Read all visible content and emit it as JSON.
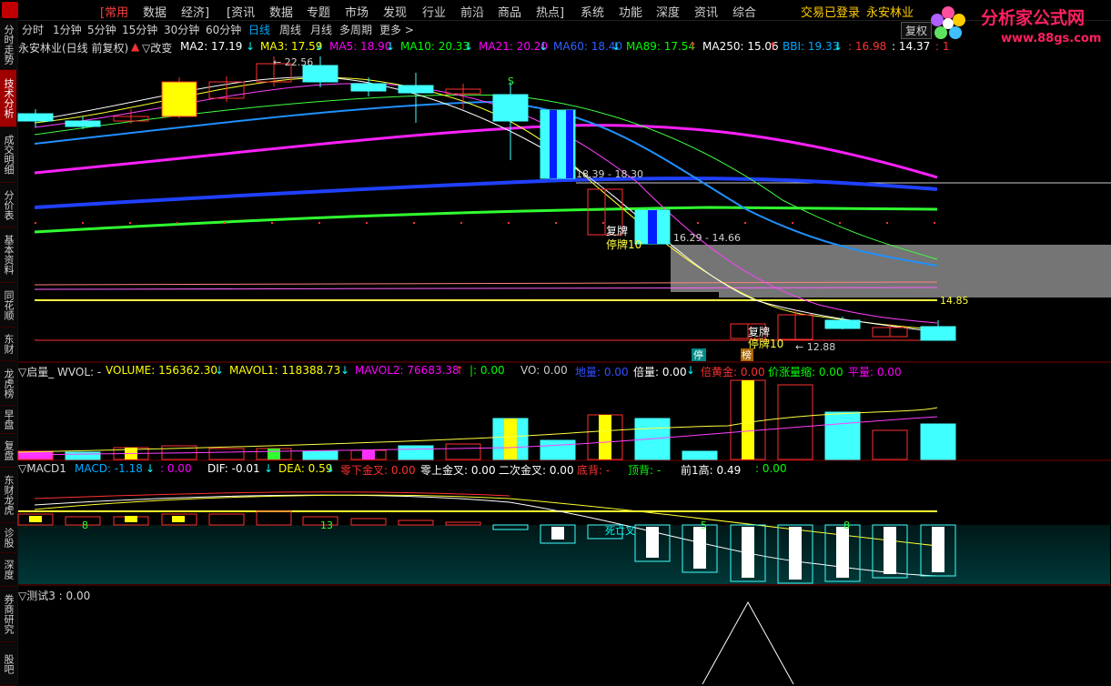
{
  "menu": {
    "items": [
      "[常用",
      "数据",
      "经济]",
      "[资讯",
      "数据",
      "专题",
      "市场",
      "发现",
      "行业",
      "前沿",
      "商品",
      "热点]",
      "系统",
      "功能",
      "深度",
      "资讯",
      "综合"
    ],
    "login_status": "交易已登录",
    "stock_name": "永安林业"
  },
  "watermark": {
    "brand": "分析家公式网",
    "url": "www.88gs.com"
  },
  "timeframes": {
    "items": [
      "分时",
      "1分钟",
      "5分钟",
      "15分钟",
      "30分钟",
      "60分钟",
      "日线",
      "周线",
      "月线",
      "多周期",
      "更多 >"
    ],
    "active": "日线"
  },
  "fuquan_label": "复权",
  "left_tabs": [
    {
      "label": "分时走势",
      "active": false
    },
    {
      "label": "技术分析",
      "active": true
    },
    {
      "label": "成交明细",
      "active": false
    },
    {
      "label": "分价表",
      "active": false
    },
    {
      "label": "基本资料",
      "active": false
    },
    {
      "label": "同花顺",
      "active": false
    },
    {
      "label": "东财",
      "active": false
    },
    {
      "label": "龙虎榜",
      "active": false
    },
    {
      "label": "早盘",
      "active": false
    },
    {
      "label": "复盘",
      "active": false
    },
    {
      "label": "东财龙虎",
      "active": false
    },
    {
      "label": "诊股",
      "active": false
    },
    {
      "label": "深度",
      "active": false
    },
    {
      "label": "券商研究",
      "active": false
    },
    {
      "label": "股吧",
      "active": false
    }
  ],
  "main_panel": {
    "title": "永安林业(日线 前复权)",
    "change_label": "▽改变",
    "indicators": [
      {
        "label": "MA2: 17.19",
        "color": "#ffffff",
        "arrow": "↓",
        "arrow_color": "#00ffff"
      },
      {
        "label": "MA3: 17.59",
        "color": "#ffff00",
        "arrow": "↓",
        "arrow_color": "#00ffff"
      },
      {
        "label": "MA5: 18.90",
        "color": "#ff00ff",
        "arrow": "↓",
        "arrow_color": "#00ffff"
      },
      {
        "label": "MA10: 20.33",
        "color": "#00ff00",
        "arrow": "↓",
        "arrow_color": "#00ffff"
      },
      {
        "label": "MA21: 20.20",
        "color": "#ff00ff",
        "arrow": "↓",
        "arrow_color": "#00ffff"
      },
      {
        "label": "MA60: 18.40",
        "color": "#3060ff",
        "arrow": "↓",
        "arrow_color": "#00ffff"
      },
      {
        "label": "MA89: 17.54",
        "color": "#00ff00",
        "arrow": "↑",
        "arrow_color": "#ff3030"
      },
      {
        "label": "MA250: 15.06",
        "color": "#ffffff",
        "arrow": "↑",
        "arrow_color": "#ff3030"
      },
      {
        "label": "BBI: 19.33",
        "color": "#00aaff",
        "arrow": "↓",
        "arrow_color": "#00ffff"
      },
      {
        "label": ": 16.98",
        "color": "#ff3030",
        "arrow": "",
        "arrow_color": ""
      },
      {
        "label": ": 14.37",
        "color": "#ffffff",
        "arrow": "",
        "arrow_color": ""
      },
      {
        "label": ": 1",
        "color": "#ff3030",
        "arrow": "",
        "arrow_color": ""
      }
    ],
    "annotations": {
      "high_label": "← 22.56",
      "price_range_1": "18.39 - 18.30",
      "price_range_2": "16.29 - 14.66",
      "resume_1": "复牌",
      "halt_1": "停牌10",
      "resume_2": "复牌",
      "halt_2": "停牌10",
      "low_label": "← 12.88",
      "right_level": "14.85",
      "s_mark": "S",
      "tag_halt": "停",
      "tag_list": "榜"
    }
  },
  "volume_panel": {
    "title": "▽启量_ WVOL: -",
    "items": [
      {
        "label": "VOLUME: 156362.30",
        "color": "#ffff00",
        "arrow": "↓",
        "arrow_color": "#00ffff"
      },
      {
        "label": "MAVOL1: 118388.73",
        "color": "#ffff00",
        "arrow": "↓",
        "arrow_color": "#00ffff"
      },
      {
        "label": "MAVOL2: 76683.38",
        "color": "#ff00ff",
        "arrow": "↑",
        "arrow_color": "#ff3030"
      },
      {
        "label": "|: 0.00",
        "color": "#00ff00",
        "arrow": "",
        "arrow_color": ""
      },
      {
        "label": "VO: 0.00",
        "color": "#c8c8c8",
        "arrow": "",
        "arrow_color": ""
      },
      {
        "label": "地量: 0.00",
        "color": "#3050ff",
        "arrow": "",
        "arrow_color": ""
      },
      {
        "label": "倍量: 0.00",
        "color": "#ffffff",
        "arrow": "↓",
        "arrow_color": "#00ffff"
      },
      {
        "label": "倍黄金: 0.00",
        "color": "#ff3030",
        "arrow": "",
        "arrow_color": ""
      },
      {
        "label": "价涨量缩: 0.00",
        "color": "#00ff00",
        "arrow": "",
        "arrow_color": ""
      },
      {
        "label": "平量: 0.00",
        "color": "#ff00ff",
        "arrow": "",
        "arrow_color": ""
      }
    ]
  },
  "macd_panel": {
    "title": "▽MACD1",
    "items": [
      {
        "label": "MACD: -1.18",
        "color": "#00aaff",
        "arrow": "↓",
        "arrow_color": "#00ffff"
      },
      {
        "label": ": 0.00",
        "color": "#ff00ff",
        "arrow": "",
        "arrow_color": ""
      },
      {
        "label": "DIF: -0.01",
        "color": "#ffffff",
        "arrow": "↓",
        "arrow_color": "#00ffff"
      },
      {
        "label": "DEA: 0.59",
        "color": "#ffff00",
        "arrow": "↓",
        "arrow_color": "#00ffff"
      },
      {
        "label": "零下金叉: 0.00",
        "color": "#ff3030",
        "arrow": "",
        "arrow_color": ""
      },
      {
        "label": "零上金叉: 0.00",
        "color": "#ffffff",
        "arrow": "",
        "arrow_color": ""
      },
      {
        "label": "二次金叉: 0.00",
        "color": "#ffffff",
        "arrow": "",
        "arrow_color": ""
      },
      {
        "label": "底背: -",
        "color": "#ff3030",
        "arrow": "",
        "arrow_color": ""
      },
      {
        "label": "顶背: -",
        "color": "#00ff00",
        "arrow": "",
        "arrow_color": ""
      },
      {
        "label": "前1高: 0.49",
        "color": "#ffffff",
        "arrow": "",
        "arrow_color": ""
      },
      {
        "label": ": 0.00",
        "color": "#00ff00",
        "arrow": "",
        "arrow_color": ""
      }
    ],
    "annotations": {
      "n1": "8",
      "n2": "13",
      "n3": "5",
      "n4": "8",
      "death_cross": "死亡叉"
    }
  },
  "test_panel": {
    "title": "▽测试3 : 0.00"
  }
}
